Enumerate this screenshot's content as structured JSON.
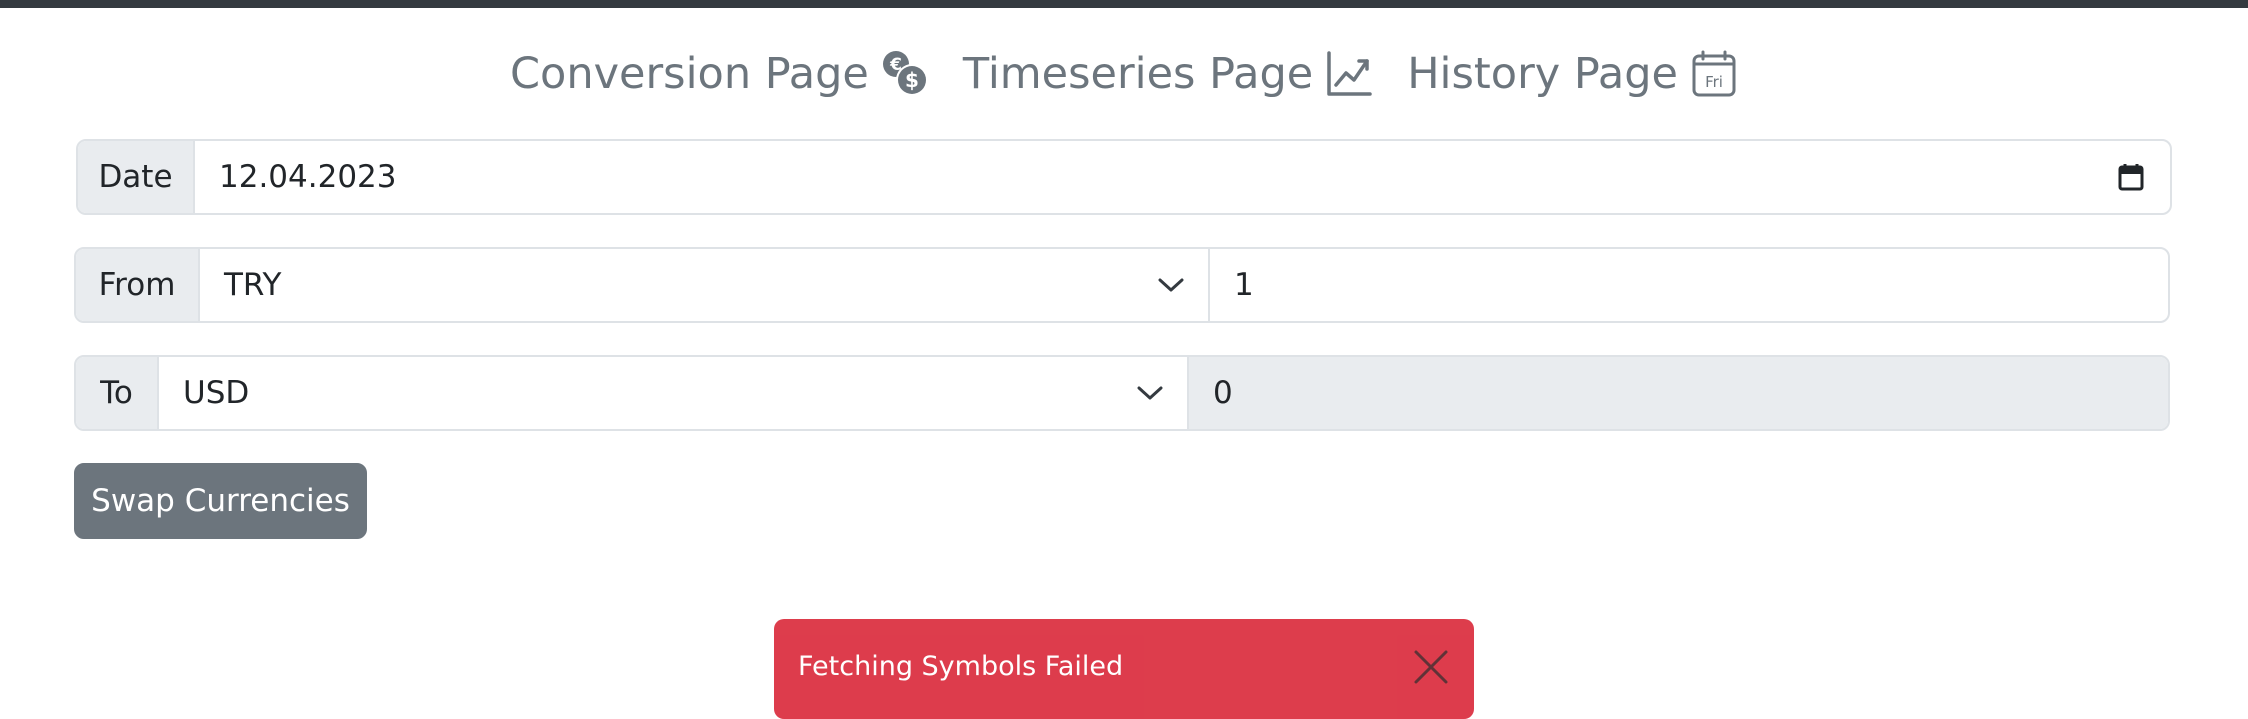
{
  "nav": {
    "links": [
      {
        "label": "Conversion Page",
        "icon": "currency-exchange-icon"
      },
      {
        "label": "Timeseries Page",
        "icon": "graph-up-icon"
      },
      {
        "label": "History Page",
        "icon": "calendar-day-icon",
        "icon_text": "Fri"
      }
    ]
  },
  "date_group": {
    "label": "Date",
    "value": "12.04.2023",
    "icon": "calendar-icon"
  },
  "from_group": {
    "label": "From",
    "currency": "TRY",
    "amount": "1"
  },
  "to_group": {
    "label": "To",
    "currency": "USD",
    "amount": "0"
  },
  "swap_button": {
    "label": "Swap Currencies"
  },
  "toast": {
    "message": "Fetching Symbols Failed",
    "close_icon": "close-icon"
  },
  "colors": {
    "topbar": "#343a40",
    "nav_text": "#6c757d",
    "addon_bg": "#e9ecef",
    "border": "#dee2e6",
    "button_secondary": "#6c757d",
    "toast_danger": "#dc3545"
  }
}
